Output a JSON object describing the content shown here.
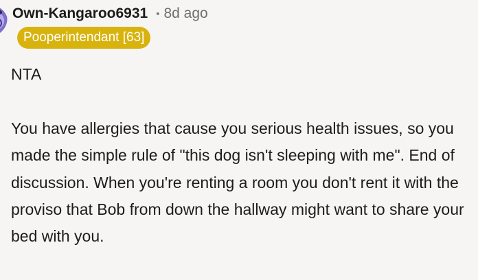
{
  "comment": {
    "username": "Own-Kangaroo6931",
    "separator": "•",
    "timestamp": "8d ago",
    "flair": "Pooperintendant [63]",
    "paragraphs": [
      "NTA",
      "You have allergies that cause you serious health issues, so you made the simple rule of \"this dog isn't sleeping with me\". End of discussion. When you're renting a room you don't rent it with the proviso that Bob from down the hallway might want to share your bed with you."
    ]
  },
  "colors": {
    "background": "#f6f5f3",
    "text": "#1c1c1c",
    "muted": "#6e6e6e",
    "flair_background": "#d8b30e",
    "flair_text": "#ffffff"
  }
}
